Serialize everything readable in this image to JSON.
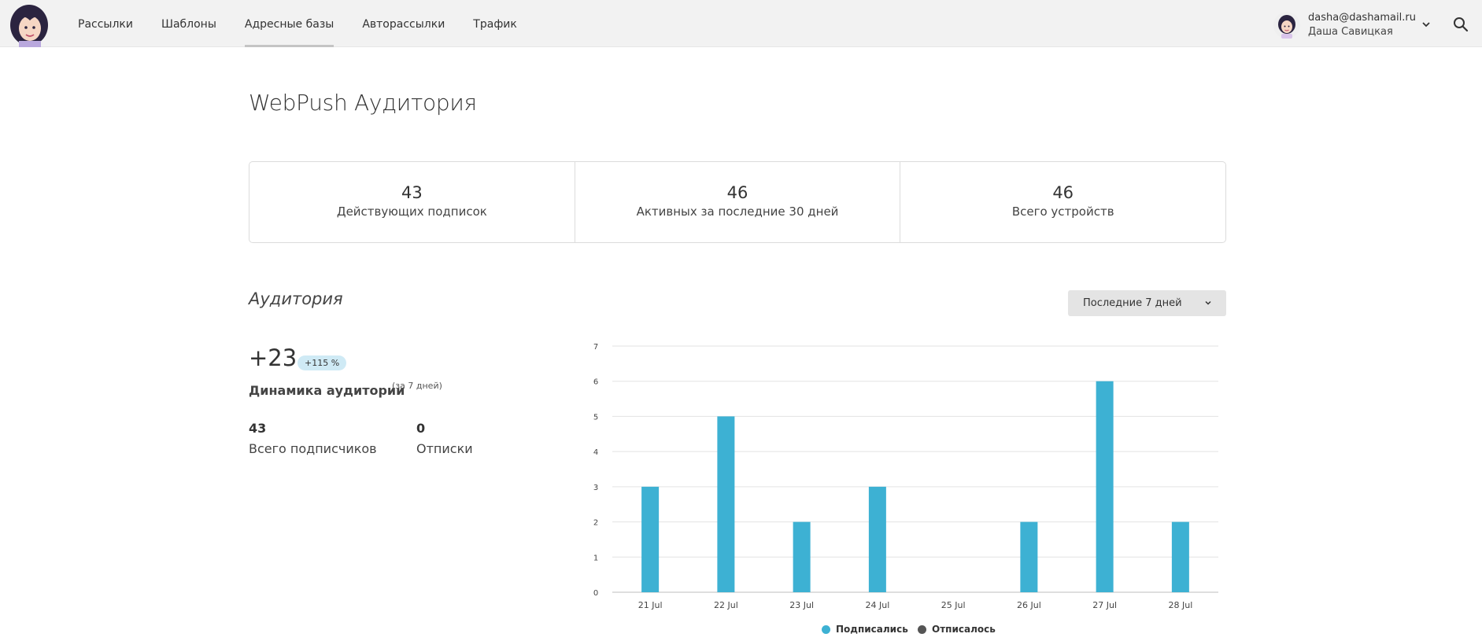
{
  "nav": {
    "items": [
      {
        "label": "Рассылки"
      },
      {
        "label": "Шаблоны"
      },
      {
        "label": "Адресные базы"
      },
      {
        "label": "Авторассылки"
      },
      {
        "label": "Трафик"
      }
    ],
    "active_index": 2
  },
  "user": {
    "email": "dasha@dashamail.ru",
    "name": "Даша Савицкая"
  },
  "page": {
    "title": "WebPush Аудитория"
  },
  "stats": [
    {
      "value": "43",
      "label": "Действующих подписок"
    },
    {
      "value": "46",
      "label": "Активных за последние 30 дней"
    },
    {
      "value": "46",
      "label": "Всего устройств"
    }
  ],
  "audience": {
    "title": "Аудитория",
    "period_select": "Последние 7 дней",
    "delta": "+23",
    "delta_badge": "+115 %",
    "dynamics_label": "Динамика аудитории",
    "dynamics_period": "(за 7 дней)",
    "total_value": "43",
    "total_label": "Всего подписчиков",
    "unsub_value": "0",
    "unsub_label": "Отписки"
  },
  "colors": {
    "accent": "#3db1d3",
    "unsubscribed": "#555555"
  },
  "chart_data": {
    "type": "bar",
    "categories": [
      "21 Jul",
      "22 Jul",
      "23 Jul",
      "24 Jul",
      "25 Jul",
      "26 Jul",
      "27 Jul",
      "28 Jul"
    ],
    "series": [
      {
        "name": "Подписались",
        "color": "#3db1d3",
        "values": [
          3,
          5,
          2,
          3,
          0,
          2,
          6,
          2
        ]
      },
      {
        "name": "Отписалось",
        "color": "#555555",
        "values": [
          0,
          0,
          0,
          0,
          0,
          0,
          0,
          0
        ]
      }
    ],
    "yticks": [
      "0",
      "1",
      "2",
      "3",
      "4",
      "5",
      "6",
      "7"
    ],
    "ylim": [
      0,
      7
    ],
    "grid": true,
    "legend_position": "bottom"
  }
}
